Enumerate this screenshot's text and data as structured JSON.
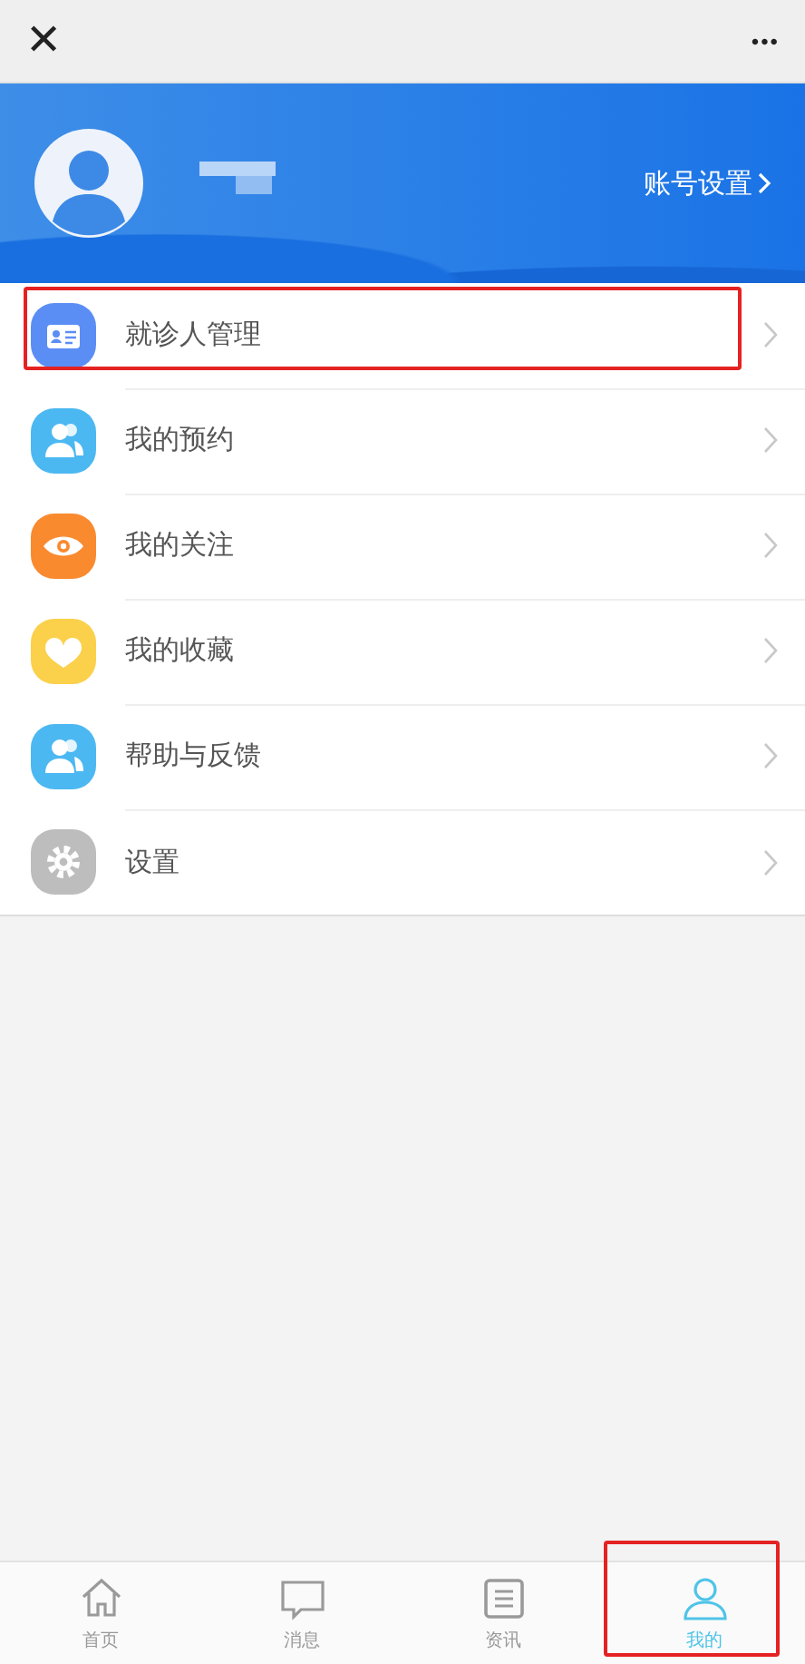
{
  "top_bar": {
    "close": "✕",
    "more": "•••"
  },
  "profile": {
    "account_link": "账号设置"
  },
  "menu": [
    {
      "label": "就诊人管理",
      "kind": "card",
      "color": "#5b8ef5",
      "highlighted": true
    },
    {
      "label": "我的预约",
      "kind": "people",
      "color": "#4cb8f2",
      "highlighted": false
    },
    {
      "label": "我的关注",
      "kind": "eye",
      "color": "#f98a2e",
      "highlighted": false
    },
    {
      "label": "我的收藏",
      "kind": "heart",
      "color": "#fbd04a",
      "highlighted": false
    },
    {
      "label": "帮助与反馈",
      "kind": "people",
      "color": "#4cb8f2",
      "highlighted": false
    },
    {
      "label": "设置",
      "kind": "gear",
      "color": "#bdbdbd",
      "highlighted": false
    }
  ],
  "tabs": [
    {
      "label": "首页",
      "kind": "home",
      "selected": false,
      "highlighted": false
    },
    {
      "label": "消息",
      "kind": "chat",
      "selected": false,
      "highlighted": false
    },
    {
      "label": "资讯",
      "kind": "news",
      "selected": false,
      "highlighted": false
    },
    {
      "label": "我的",
      "kind": "person",
      "selected": true,
      "highlighted": true
    }
  ]
}
